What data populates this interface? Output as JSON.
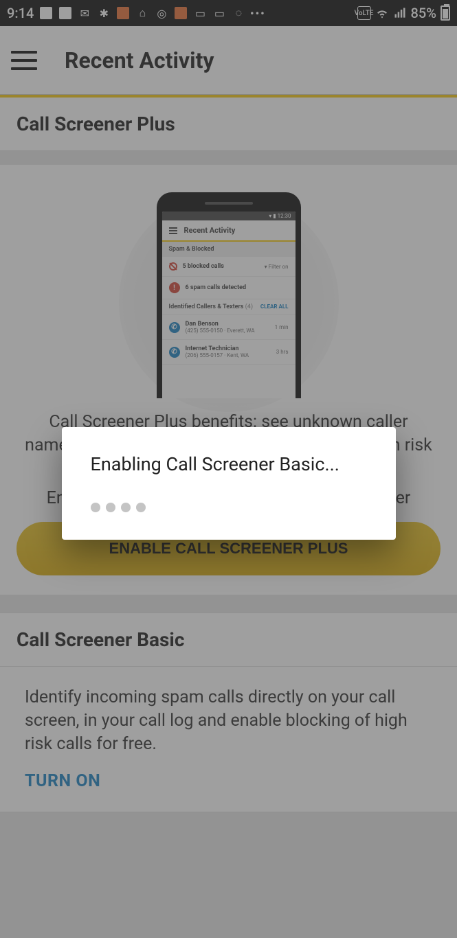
{
  "status": {
    "time": "9:14",
    "battery": "85%"
  },
  "appbar": {
    "title": "Recent Activity"
  },
  "plus": {
    "header": "Call Screener Plus",
    "desc": "Call Screener Plus benefits: see unknown caller names, identified robocaller names and the spam risk level.",
    "sub": "Enjoy a free 30-day trial, $3.99/month thereafter",
    "cta": "ENABLE CALL SCREENER PLUS"
  },
  "basic": {
    "header": "Call Screener Basic",
    "desc": "Identify incoming spam calls directly on your call screen, in your call log and enable blocking of high risk calls for free.",
    "turn_on": "TURN ON"
  },
  "dialog": {
    "title": "Enabling Call Screener Basic..."
  },
  "illus": {
    "status_time": "12:30",
    "appbar": "Recent Activity",
    "spam_head": "Spam & Blocked",
    "r1_text": "5 blocked calls",
    "r1_right": "▾ Filter on",
    "r2_text": "6 spam calls detected",
    "id_head": "Identified Callers & Texters",
    "id_count": "(4)",
    "clear": "CLEAR ALL",
    "c1_name": "Dan Benson",
    "c1_num": "(425) 555-0150 · Everett, WA",
    "c1_time": "1 min",
    "c2_name": "Internet Technician",
    "c2_num": "(206) 555-0157 · Kent, WA",
    "c2_time": "3 hrs"
  }
}
